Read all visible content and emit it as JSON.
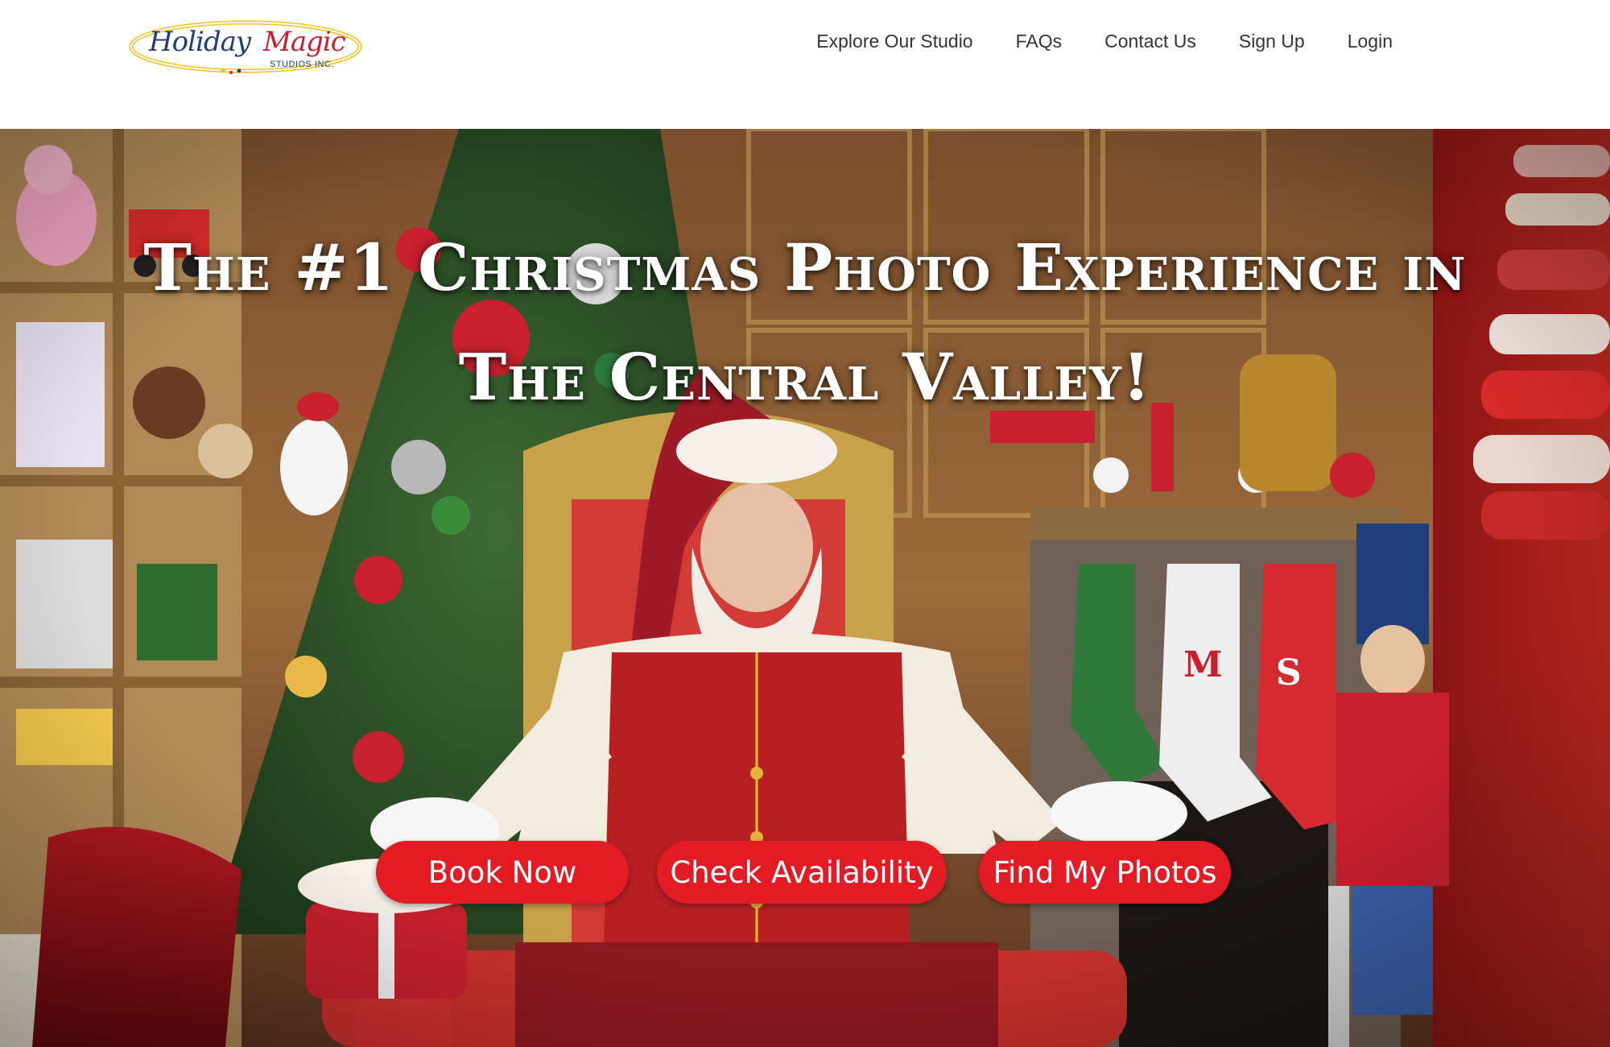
{
  "brand": {
    "logo_word1": "Holiday",
    "logo_word2": "Magic",
    "logo_sub": "STUDIOS INC.",
    "colors": {
      "navy": "#1f3e7a",
      "red": "#c8202e",
      "gold": "#f2c21b"
    }
  },
  "nav": {
    "items": [
      {
        "label": "Explore Our Studio"
      },
      {
        "label": "FAQs"
      },
      {
        "label": "Contact Us"
      },
      {
        "label": "Sign Up"
      },
      {
        "label": "Login"
      }
    ]
  },
  "hero": {
    "title_line1": "The #1 Christmas Photo Experience in",
    "title_line2": "The Central Valley!",
    "background_description_icon": "santa-photo",
    "stocking_letters": [
      "M",
      "S"
    ],
    "buttons": [
      {
        "label": "Book Now"
      },
      {
        "label": "Check Availability"
      },
      {
        "label": "Find My Photos"
      }
    ],
    "button_color": "#e21b24"
  }
}
